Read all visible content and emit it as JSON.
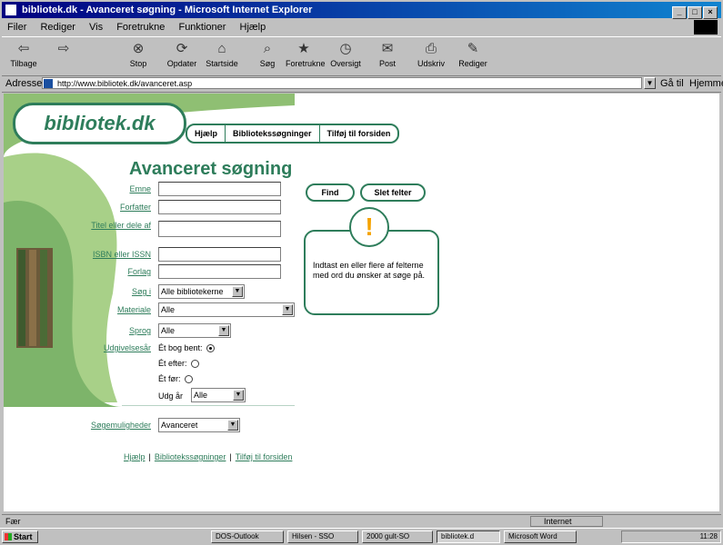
{
  "window": {
    "title": "bibliotek.dk - Avanceret søgning - Microsoft Internet Explorer"
  },
  "menu": [
    "Filer",
    "Rediger",
    "Vis",
    "Foretrukne",
    "Funktioner",
    "Hjælp"
  ],
  "toolbar": [
    {
      "label": "Tilbage",
      "icon": "back-arrow-icon",
      "glyph": "⇦"
    },
    {
      "label": "",
      "icon": "forward-arrow-icon",
      "glyph": "⇨"
    },
    {
      "label": "Stop",
      "icon": "stop-icon",
      "glyph": "⊗"
    },
    {
      "label": "Opdater",
      "icon": "refresh-icon",
      "glyph": "⟳"
    },
    {
      "label": "Startside",
      "icon": "home-icon",
      "glyph": "⌂"
    },
    {
      "label": "Søg",
      "icon": "search-icon",
      "glyph": "⌕"
    },
    {
      "label": "Foretrukne",
      "icon": "favorites-icon",
      "glyph": "★"
    },
    {
      "label": "Oversigt",
      "icon": "history-icon",
      "glyph": "◷"
    },
    {
      "label": "Post",
      "icon": "mail-icon",
      "glyph": "✉"
    },
    {
      "label": "Udskriv",
      "icon": "print-icon",
      "glyph": "⎙"
    },
    {
      "label": "Rediger",
      "icon": "edit-icon",
      "glyph": "✎"
    }
  ],
  "address": {
    "label": "Adresse",
    "url": "http://www.bibliotek.dk/avanceret.asp",
    "go": "Gå til",
    "links": "Hjemmesi"
  },
  "page": {
    "logo": "bibliotek.dk",
    "nav": [
      "Hjælp",
      "Bibliotekssøgninger",
      "Tilføj til forsiden"
    ],
    "heading": "Avanceret søgning",
    "fields": [
      {
        "label": "Emne"
      },
      {
        "label": "Forfatter"
      },
      {
        "label": "Titel eller dele af"
      },
      {
        "label": "ISBN eller ISSN"
      },
      {
        "label": "Forlag"
      }
    ],
    "selects": [
      {
        "label": "Søg i",
        "value": "Alle bibliotekerne"
      },
      {
        "label": "Materiale",
        "value": "Alle"
      },
      {
        "label": "Sprog",
        "value": "Alle"
      }
    ],
    "year": {
      "label": "Udgivelsesår",
      "options": [
        {
          "text": "Ét bog bent:",
          "checked": true
        },
        {
          "text": "Ét efter:",
          "checked": false
        },
        {
          "text": "Ét før:",
          "checked": false
        }
      ],
      "year_label": "Udg år",
      "year_value": "Alle"
    },
    "search_options": {
      "label": "Søgemuligheder",
      "value": "Avanceret"
    },
    "buttons": {
      "find": "Find",
      "clear": "Slet felter"
    },
    "info": {
      "text": "Indtast en eller flere af felterne med ord du ønsker at søge på."
    },
    "footer": [
      "Hjælp",
      "Bibliotekssøgninger",
      "Tilføj til forsiden"
    ]
  },
  "status": {
    "left": "Fær",
    "zone": "Internet"
  },
  "taskbar": {
    "start": "Start",
    "tasks": [
      {
        "label": "DOS-Outlook",
        "active": false
      },
      {
        "label": "Hilsen - SSO",
        "active": false
      },
      {
        "label": "2000 gult-SO",
        "active": false
      },
      {
        "label": "bibliotek.d",
        "active": true
      },
      {
        "label": "Microsoft Word",
        "active": false
      }
    ],
    "clock": "11:28"
  }
}
